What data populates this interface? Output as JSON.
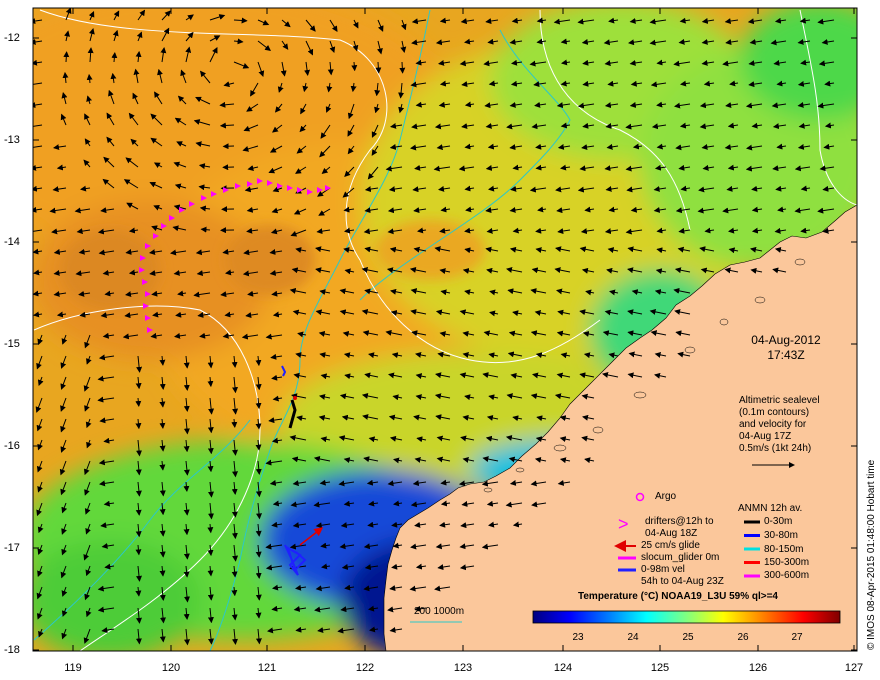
{
  "axes": {
    "lat_ticks": [
      "-12",
      "-13",
      "-14",
      "-15",
      "-16",
      "-17",
      "-18"
    ],
    "lon_ticks": [
      "119",
      "120",
      "121",
      "122",
      "123",
      "124",
      "125",
      "126",
      "127"
    ]
  },
  "datetime": {
    "date": "04-Aug-2012",
    "time": "17:43Z"
  },
  "altimetry_note": {
    "line1": "Altimetric sealevel",
    "line2": "(0.1m contours)",
    "line3": "and velocity for",
    "line4": "04-Aug 17Z",
    "line5": "0.5m/s (1kt 24h)"
  },
  "legend": {
    "argo": "Argo",
    "drifters_line1": "drifters@12h to",
    "drifters_line2": "04-Aug 18Z",
    "glide": "25 cm/s glide",
    "slocum": "slocum_glider 0m",
    "vel_line1": "0-98m vel",
    "vel_line2": "54h to 04-Aug 23Z",
    "anmn_title": "ANMN 12h av.",
    "anmn_items": [
      "0-30m",
      "30-80m",
      "80-150m",
      "150-300m",
      "300-600m"
    ],
    "anmn_colors": [
      "#000000",
      "#0000ff",
      "#00e0e0",
      "#ff0000",
      "#ff00ff"
    ],
    "bathy": "200 1000m"
  },
  "colorbar": {
    "title": "Temperature (°C) NOAA19_L3U 59% ql>=4",
    "ticks": [
      "23",
      "24",
      "25",
      "26",
      "27"
    ],
    "range": [
      22.2,
      27.8
    ],
    "colors": [
      "#00007f",
      "#0000ff",
      "#0080ff",
      "#00ffff",
      "#80ff80",
      "#ffff00",
      "#ff8000",
      "#ff0000",
      "#7f0000"
    ]
  },
  "credit": "© IMOS 08-Apr-2015 01:48:00 Hobart time",
  "colors": {
    "land": "#fbc79b",
    "warm_sea": "#f2a21a",
    "mid_sea": "#d8d224",
    "cool_sea": "#52d83c",
    "cold_sea": "#000f8f",
    "contour_white": "#ffffff",
    "contour_cyan": "#2cc8c8",
    "drifter": "#ff00ff",
    "glider": "#ff0000"
  }
}
